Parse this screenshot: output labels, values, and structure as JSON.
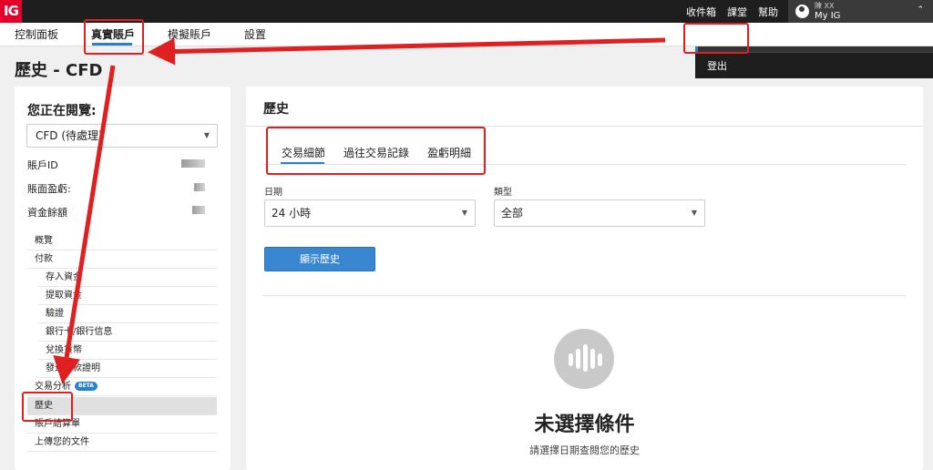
{
  "topbar": {
    "logo": "IG",
    "links": [
      "收件箱",
      "課堂",
      "幫助"
    ],
    "user_name": "陳 XX",
    "user_sub": "My IG",
    "caret": "⌃"
  },
  "user_menu": {
    "items": [
      "My IG",
      "登出"
    ]
  },
  "nav": {
    "items": [
      "控制面板",
      "真實賬戶",
      "模擬賬戶",
      "設置"
    ]
  },
  "page": {
    "title": "歷史 - CFD"
  },
  "left_panel": {
    "heading": "您正在閱覽:",
    "account_select": "CFD (待處理)",
    "info": [
      "賬戶ID",
      "賬面盈虧:",
      "資金餘額"
    ],
    "menu": [
      {
        "label": "概覽"
      },
      {
        "label": "付款"
      },
      {
        "label": "存入資金"
      },
      {
        "label": "提取資金"
      },
      {
        "label": "驗證"
      },
      {
        "label": "銀行卡/銀行信息"
      },
      {
        "label": "兌換貨幣"
      },
      {
        "label": "發送付款證明"
      },
      {
        "label": "交易分析",
        "badge": "BETA"
      },
      {
        "label": "歷史"
      },
      {
        "label": "賬戶結算單"
      },
      {
        "label": "上傳您的文件"
      }
    ]
  },
  "right_panel": {
    "title": "歷史",
    "tabs": [
      "交易細節",
      "過往交易記錄",
      "盈虧明細"
    ],
    "date_label": "日期",
    "date_value": "24 小時",
    "type_label": "類型",
    "type_value": "全部",
    "show_button": "顯示歷史",
    "empty_title": "未選擇條件",
    "empty_sub": "請選擇日期查閱您的歷史"
  },
  "colors": {
    "brand_red": "#e4002b",
    "accent_blue": "#2a7fd4",
    "annotation_red": "#e02020"
  }
}
